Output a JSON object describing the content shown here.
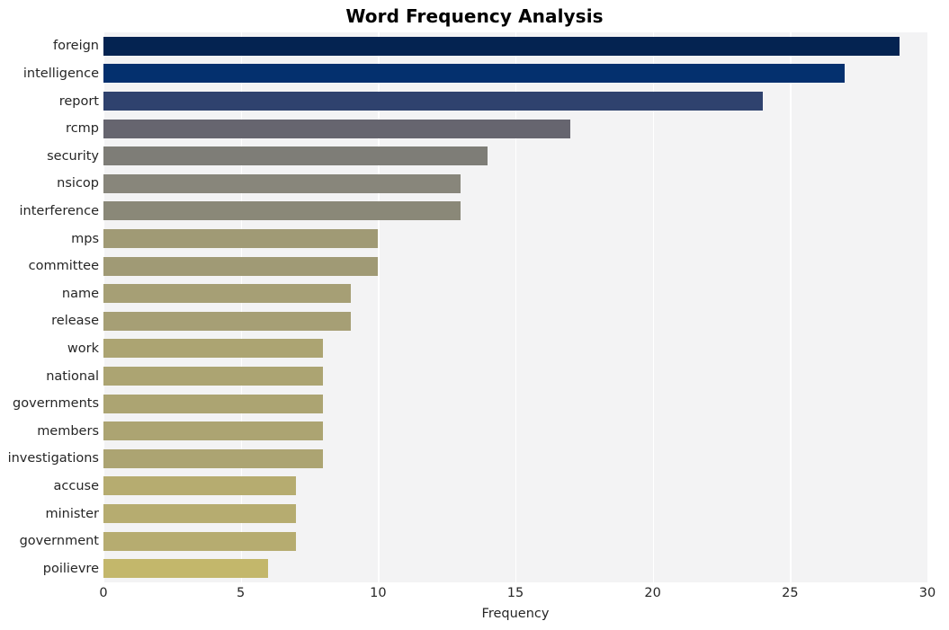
{
  "chart_data": {
    "type": "bar",
    "orientation": "horizontal",
    "title": "Word Frequency Analysis",
    "xlabel": "Frequency",
    "ylabel": "",
    "xlim": [
      0,
      30
    ],
    "xticks": [
      0,
      5,
      10,
      15,
      20,
      25,
      30
    ],
    "xtick_labels": [
      "0",
      "5",
      "10",
      "15",
      "20",
      "25",
      "30"
    ],
    "grid": true,
    "grid_axis": "x",
    "legend": null,
    "colormap": "cividis",
    "categories": [
      "foreign",
      "intelligence",
      "report",
      "rcmp",
      "security",
      "nsicop",
      "interference",
      "mps",
      "committee",
      "name",
      "release",
      "work",
      "national",
      "governments",
      "members",
      "investigations",
      "accuse",
      "minister",
      "government",
      "poilievre"
    ],
    "values": [
      29,
      27,
      24,
      17,
      14,
      13,
      13,
      10,
      10,
      9,
      9,
      8,
      8,
      8,
      8,
      8,
      7,
      7,
      7,
      6
    ],
    "bar_colors": [
      "#042351",
      "#04306e",
      "#2f426e",
      "#66656f",
      "#7e7d77",
      "#88867b",
      "#8a8878",
      "#a09a75",
      "#a09a75",
      "#a69f75",
      "#a69f75",
      "#aca472",
      "#aca472",
      "#aca472",
      "#aca472",
      "#aca472",
      "#b6ac70",
      "#b6ac70",
      "#b6ac70",
      "#c3b76b"
    ]
  },
  "figure": {
    "background_color": "#ffffff",
    "plot_background_color": "#f3f3f4",
    "grid_color": "#ffffff",
    "tick_label_color": "#262626",
    "title_color": "#000000"
  }
}
